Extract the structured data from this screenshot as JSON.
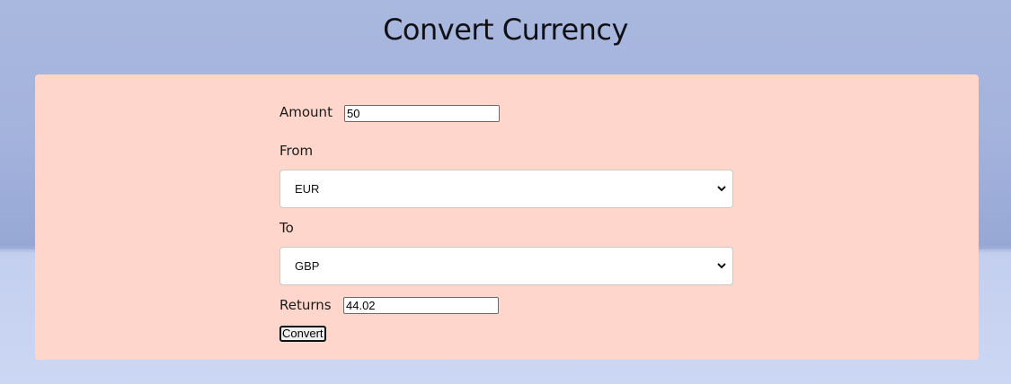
{
  "page": {
    "title": "Convert Currency"
  },
  "form": {
    "amount_label": "Amount",
    "amount_value": "50",
    "from_label": "From",
    "from_selected": "EUR",
    "to_label": "To",
    "to_selected": "GBP",
    "returns_label": "Returns",
    "returns_value": "44.02",
    "convert_label": "Convert"
  },
  "colors": {
    "card_background": "#ffd6cc",
    "page_background": "#a4b3dc"
  },
  "icons": {
    "select_arrow": "chevron-down-icon"
  }
}
